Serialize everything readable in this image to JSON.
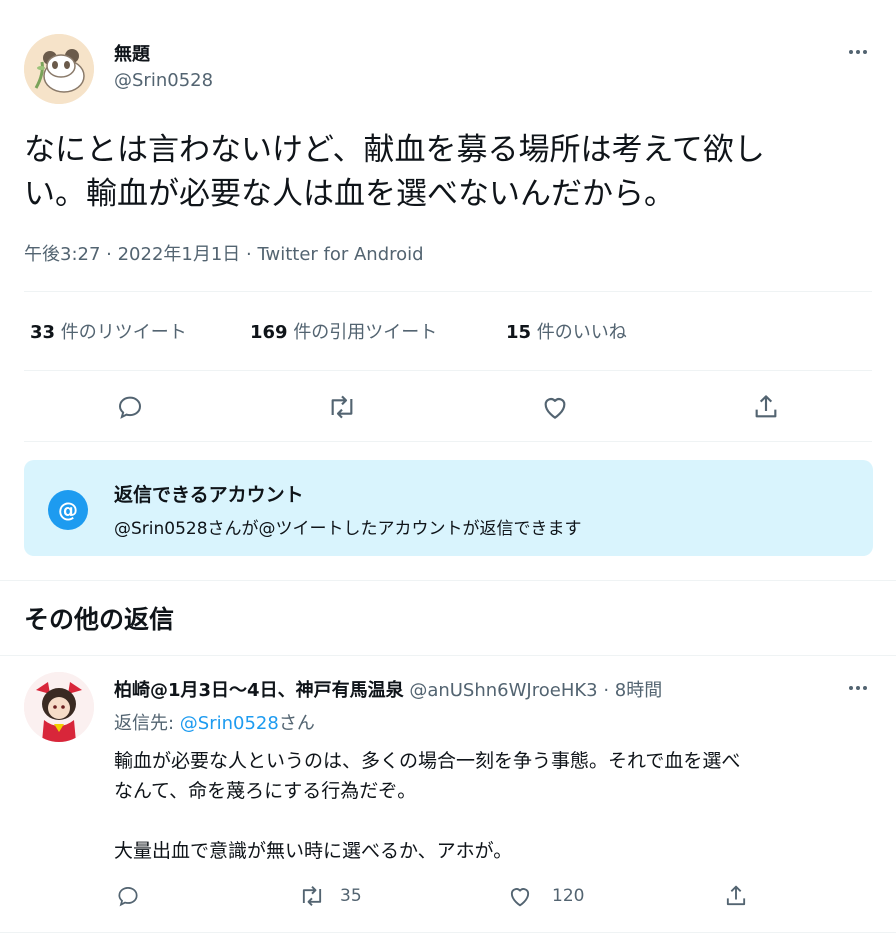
{
  "main_tweet": {
    "display_name": "無題",
    "handle": "@Srin0528",
    "text_line1": "なにとは言わないけど、献血を募る場所は考えて欲し",
    "text_line2": "い。輸血が必要な人は血を選べないんだから。",
    "timestamp": "午後3:27 · 2022年1月1日 · Twitter for Android",
    "stats": {
      "retweets_count": "33",
      "retweets_label": "件のリツイート",
      "quotes_count": "169",
      "quotes_label": "件の引用ツイート",
      "likes_count": "15",
      "likes_label": "件のいいね"
    },
    "icons": [
      "reply-icon",
      "retweet-icon",
      "like-icon",
      "share-icon",
      "more-icon"
    ]
  },
  "reply_restriction": {
    "title": "返信できるアカウント",
    "description": "@Srin0528さんが@ツイートしたアカウントが返信できます",
    "icon_glyph": "@",
    "accent": "#1d9bf0",
    "background": "#d9f4fd"
  },
  "more_replies": {
    "heading": "その他の返信"
  },
  "reply": {
    "display_name": "柏崎@1月3日〜4日、神戸有馬温泉",
    "handle": "@anUShn6WJroeHK3",
    "time": "· 8時間",
    "replying_to_prefix": "返信先: ",
    "replying_to_handle": "@Srin0528",
    "replying_to_suffix": "さん",
    "text_line1": "輸血が必要な人というのは、多くの場合一刻を争う事態。それで血を選べ",
    "text_line2": "なんて、命を蔑ろにする行為だぞ。",
    "text_line3": "大量出血で意識が無い時に選べるか、アホが。",
    "retweets": "35",
    "likes": "120"
  },
  "colors": {
    "text": "#0f1419",
    "muted": "#536471",
    "link": "#1d9bf0",
    "divider": "#eff3f4"
  }
}
